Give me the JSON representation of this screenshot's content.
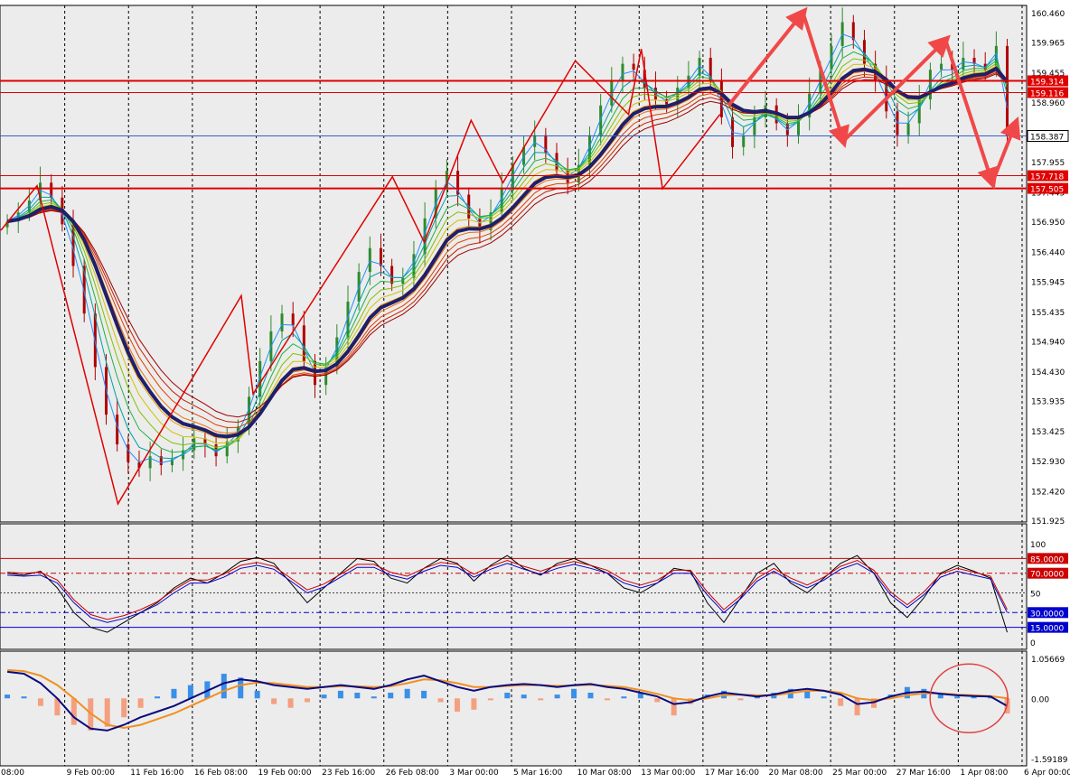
{
  "chart_data": {
    "type": "candlestick",
    "colors": {
      "background": "#ffffff",
      "plot_bg": "#ececec",
      "grid": "#000000",
      "bull": "#2e8b2e",
      "bear": "#b00000",
      "zigzag": "#e00000",
      "arrow": "#f04848",
      "slow_ma": "#1f1f6a",
      "level_line": "#e00000",
      "price_line": "#3060d0",
      "stoch_main": "#000000",
      "stoch_blue": "#0000cc",
      "stoch_red": "#cc0000",
      "hist_pos": "#3a8fe8",
      "hist_neg": "#f4a080",
      "macd_main": "#0a0a80",
      "macd_signal": "#f09020",
      "circle": "#e04040"
    },
    "price_axis": {
      "ticks": [
        "160.460",
        "159.965",
        "159.455",
        "158.960",
        "157.955",
        "157.445",
        "156.950",
        "156.440",
        "155.945",
        "155.435",
        "154.940",
        "154.430",
        "153.935",
        "153.425",
        "152.930",
        "152.420",
        "151.925"
      ],
      "range": [
        151.925,
        160.46
      ]
    },
    "price_labels": [
      {
        "text": "159.314",
        "value": 159.314,
        "kind": "level"
      },
      {
        "text": "159.116",
        "value": 159.116,
        "kind": "level"
      },
      {
        "text": "158.387",
        "value": 158.387,
        "kind": "current"
      },
      {
        "text": "157.718",
        "value": 157.718,
        "kind": "level"
      },
      {
        "text": "157.505",
        "value": 157.505,
        "kind": "level"
      }
    ],
    "time_axis": [
      "08:00",
      "9 Feb 00:00",
      "11 Feb 16:00",
      "16 Feb 08:00",
      "19 Feb 00:00",
      "23 Feb 16:00",
      "26 Feb 08:00",
      "3 Mar 00:00",
      "5 Mar 16:00",
      "10 Mar 08:00",
      "13 Mar 00:00",
      "17 Mar 16:00",
      "20 Mar 08:00",
      "25 Mar 00:00",
      "27 Mar 16:00",
      "1 Apr 08:00",
      "6 Apr 00:00"
    ],
    "close_series": [
      156.95,
      157.1,
      157.3,
      157.6,
      157.35,
      156.9,
      156.2,
      155.4,
      154.5,
      153.7,
      153.2,
      152.9,
      152.8,
      153.0,
      152.85,
      152.95,
      153.1,
      153.3,
      153.2,
      153.0,
      153.25,
      153.5,
      154.0,
      154.6,
      155.1,
      155.4,
      155.2,
      154.6,
      154.2,
      154.5,
      155.0,
      155.6,
      156.1,
      156.5,
      156.2,
      155.9,
      156.0,
      156.4,
      157.0,
      157.5,
      157.8,
      157.4,
      157.0,
      156.8,
      157.1,
      157.5,
      157.9,
      158.2,
      158.4,
      158.1,
      157.8,
      157.6,
      157.9,
      158.4,
      158.9,
      159.3,
      159.6,
      159.5,
      159.2,
      159.0,
      158.9,
      159.2,
      159.4,
      159.7,
      159.3,
      158.7,
      158.2,
      158.4,
      158.7,
      158.9,
      158.6,
      158.4,
      158.7,
      159.1,
      159.5,
      159.9,
      160.3,
      160.0,
      159.6,
      159.3,
      158.8,
      158.4,
      158.6,
      159.0,
      159.5,
      159.6,
      159.5,
      159.7,
      159.6,
      159.5,
      159.9,
      158.39
    ],
    "zigzag_points": [
      {
        "t": 0.0,
        "p": 156.8
      },
      {
        "t": 1.7,
        "p": 157.55
      },
      {
        "t": 5.5,
        "p": 152.2
      },
      {
        "t": 11.3,
        "p": 155.7
      },
      {
        "t": 11.85,
        "p": 154.05
      },
      {
        "t": 18.4,
        "p": 157.7
      },
      {
        "t": 19.9,
        "p": 156.6
      },
      {
        "t": 22.1,
        "p": 158.65
      },
      {
        "t": 23.6,
        "p": 157.6
      },
      {
        "t": 27.0,
        "p": 159.65
      },
      {
        "t": 29.5,
        "p": 158.75
      },
      {
        "t": 30.1,
        "p": 159.85
      },
      {
        "t": 31.1,
        "p": 157.5
      },
      {
        "t": 33.8,
        "p": 158.75
      }
    ],
    "arrows": [
      {
        "from": {
          "t": 34.2,
          "p": 158.9
        },
        "to": {
          "t": 37.7,
          "p": 160.46
        }
      },
      {
        "from": {
          "t": 37.7,
          "p": 160.46
        },
        "to": {
          "t": 39.6,
          "p": 158.3
        }
      },
      {
        "from": {
          "t": 39.6,
          "p": 158.3
        },
        "to": {
          "t": 44.4,
          "p": 160.0
        }
      },
      {
        "from": {
          "t": 44.4,
          "p": 160.0
        },
        "to": {
          "t": 46.6,
          "p": 157.6
        }
      },
      {
        "from": {
          "t": 46.6,
          "p": 157.6
        },
        "to": {
          "t": 47.7,
          "p": 158.6
        }
      }
    ],
    "stochastic": {
      "axis_labels": [
        "100",
        "85.0000",
        "70.0000",
        "50",
        "30.0000",
        "15.0000",
        "0"
      ],
      "levels": [
        85,
        70,
        50,
        30,
        15
      ],
      "main": [
        70,
        68,
        72,
        55,
        30,
        15,
        10,
        20,
        30,
        40,
        55,
        65,
        60,
        70,
        82,
        86,
        80,
        60,
        40,
        55,
        70,
        85,
        82,
        65,
        60,
        75,
        85,
        80,
        62,
        78,
        88,
        75,
        68,
        80,
        85,
        78,
        70,
        55,
        50,
        60,
        75,
        72,
        40,
        20,
        45,
        70,
        80,
        60,
        50,
        65,
        80,
        88,
        70,
        40,
        25,
        45,
        70,
        78,
        72,
        65,
        10
      ],
      "smooth": [
        68,
        67,
        68,
        60,
        40,
        25,
        20,
        24,
        30,
        38,
        50,
        60,
        60,
        66,
        75,
        78,
        74,
        62,
        50,
        56,
        66,
        76,
        76,
        68,
        64,
        72,
        78,
        76,
        66,
        74,
        80,
        74,
        69,
        75,
        79,
        75,
        70,
        60,
        55,
        60,
        70,
        70,
        48,
        30,
        44,
        62,
        72,
        62,
        55,
        63,
        74,
        80,
        70,
        48,
        35,
        48,
        66,
        72,
        68,
        64,
        30
      ]
    },
    "macd": {
      "axis_labels": [
        "1.05669",
        "0.00",
        "-1.59189"
      ],
      "range": [
        -1.59189,
        1.05669
      ],
      "histogram": [
        0.1,
        0.05,
        -0.2,
        -0.45,
        -0.7,
        -0.85,
        -0.75,
        -0.5,
        -0.25,
        0.05,
        0.25,
        0.35,
        0.45,
        0.65,
        0.55,
        0.2,
        -0.15,
        -0.25,
        -0.1,
        0.1,
        0.2,
        0.15,
        0.05,
        0.15,
        0.25,
        0.2,
        -0.1,
        -0.35,
        -0.3,
        -0.05,
        0.15,
        0.1,
        -0.05,
        0.1,
        0.25,
        0.15,
        -0.05,
        0.05,
        0.15,
        -0.1,
        -0.45,
        -0.15,
        0.1,
        0.2,
        -0.05,
        0.05,
        0.15,
        0.25,
        0.2,
        0.05,
        -0.2,
        -0.45,
        -0.25,
        0.1,
        0.3,
        0.25,
        0.1,
        0.05,
        0.1,
        0.05,
        -0.4
      ],
      "main": [
        0.7,
        0.65,
        0.4,
        0.0,
        -0.5,
        -0.8,
        -0.85,
        -0.7,
        -0.5,
        -0.35,
        -0.2,
        0.0,
        0.2,
        0.4,
        0.5,
        0.45,
        0.35,
        0.3,
        0.25,
        0.3,
        0.35,
        0.3,
        0.25,
        0.35,
        0.5,
        0.6,
        0.45,
        0.3,
        0.2,
        0.3,
        0.35,
        0.38,
        0.35,
        0.3,
        0.35,
        0.38,
        0.3,
        0.25,
        0.15,
        0.05,
        -0.15,
        -0.1,
        0.05,
        0.15,
        0.1,
        0.05,
        0.1,
        0.2,
        0.25,
        0.2,
        0.1,
        -0.15,
        -0.1,
        0.05,
        0.15,
        0.18,
        0.12,
        0.08,
        0.06,
        0.05,
        -0.2
      ],
      "signal": [
        0.75,
        0.72,
        0.6,
        0.35,
        0.0,
        -0.4,
        -0.7,
        -0.78,
        -0.7,
        -0.55,
        -0.4,
        -0.2,
        0.0,
        0.2,
        0.35,
        0.42,
        0.4,
        0.35,
        0.3,
        0.3,
        0.32,
        0.32,
        0.3,
        0.32,
        0.4,
        0.5,
        0.48,
        0.4,
        0.3,
        0.3,
        0.33,
        0.35,
        0.35,
        0.33,
        0.34,
        0.36,
        0.33,
        0.3,
        0.22,
        0.12,
        0.0,
        -0.05,
        0.0,
        0.08,
        0.1,
        0.08,
        0.08,
        0.14,
        0.2,
        0.2,
        0.15,
        0.0,
        -0.05,
        0.0,
        0.08,
        0.13,
        0.13,
        0.1,
        0.08,
        0.06,
        0.0
      ]
    }
  }
}
